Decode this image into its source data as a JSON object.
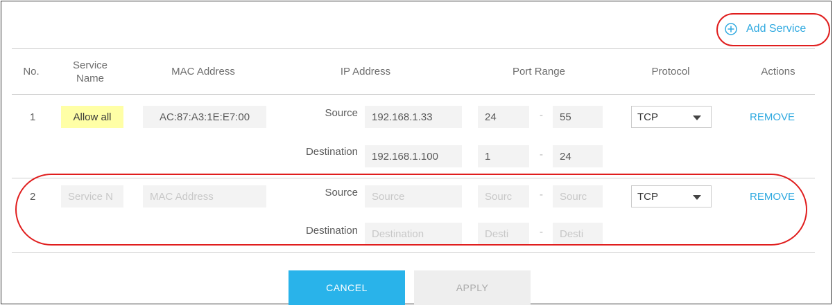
{
  "toolbar": {
    "add_service_label": "Add Service"
  },
  "table": {
    "headers": {
      "no": "No.",
      "service_name": "Service\nName",
      "mac_address": "MAC Address",
      "ip_address": "IP Address",
      "port_range": "Port Range",
      "protocol": "Protocol",
      "actions": "Actions"
    },
    "rows": [
      {
        "no": "1",
        "service_name": "Allow all",
        "mac_address": "AC:87:A3:1E:E7:00",
        "source_label": "Source",
        "destination_label": "Destination",
        "source_ip": "192.168.1.33",
        "destination_ip": "192.168.1.100",
        "source_port_start": "24",
        "source_port_end": "55",
        "destination_port_start": "1",
        "destination_port_end": "24",
        "port_separator": "-",
        "protocol": "TCP",
        "action": "REMOVE"
      },
      {
        "no": "2",
        "service_name_placeholder": "Service N",
        "mac_address_placeholder": "MAC Address",
        "source_label": "Source",
        "destination_label": "Destination",
        "source_ip_placeholder": "Source",
        "destination_ip_placeholder": "Destination",
        "source_port_start_placeholder": "Sourc",
        "source_port_end_placeholder": "Sourc",
        "destination_port_start_placeholder": "Desti",
        "destination_port_end_placeholder": "Desti",
        "port_separator": "-",
        "protocol": "TCP",
        "action": "REMOVE"
      }
    ]
  },
  "buttons": {
    "cancel": "CANCEL",
    "apply": "APPLY"
  },
  "colors": {
    "accent": "#2fa9e0",
    "highlight": "#ffffa6",
    "callout": "#e01e1e"
  }
}
